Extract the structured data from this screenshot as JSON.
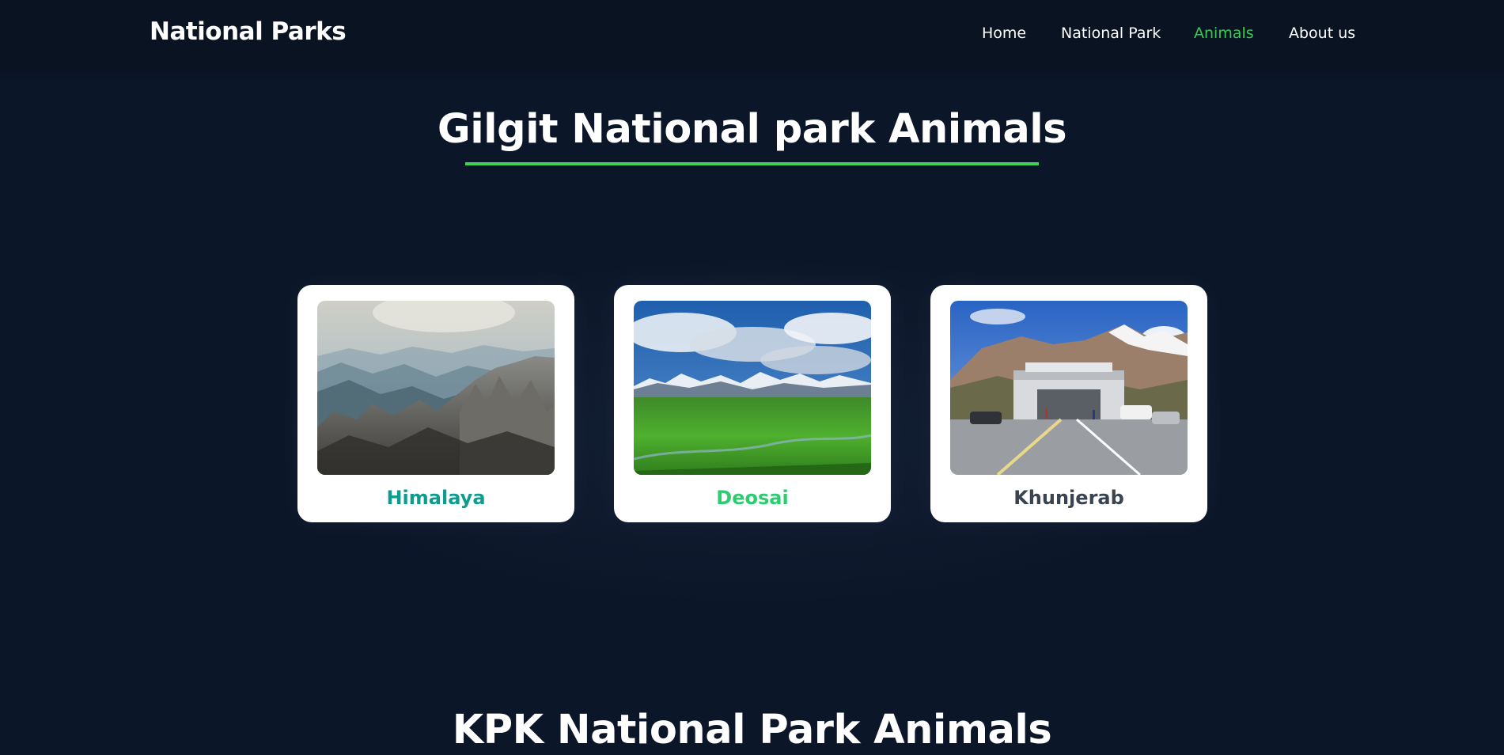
{
  "nav": {
    "brand": "National Parks",
    "links": [
      {
        "label": "Home",
        "active": false
      },
      {
        "label": "National Park",
        "active": false
      },
      {
        "label": "Animals",
        "active": true
      },
      {
        "label": "About us",
        "active": false
      }
    ]
  },
  "sections": [
    {
      "title": "Gilgit National park Animals",
      "cards": [
        {
          "label": "Himalaya",
          "color": "#0f9b8e",
          "image_icon": "mountain-mist-image"
        },
        {
          "label": "Deosai",
          "color": "#2ecc71",
          "image_icon": "green-plains-image"
        },
        {
          "label": "Khunjerab",
          "color": "#3a4451",
          "image_icon": "border-gate-image"
        }
      ]
    },
    {
      "title": "KPK National Park Animals"
    }
  ],
  "colors": {
    "background": "#0c1629",
    "navbar": "#0a1322",
    "accent": "#33cc55"
  }
}
